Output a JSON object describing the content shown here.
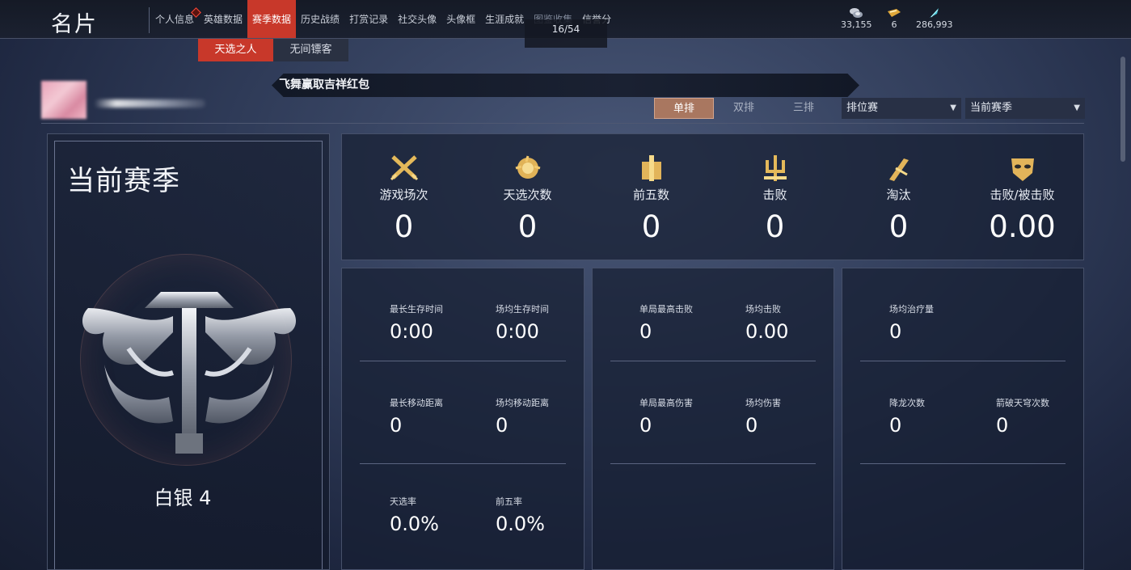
{
  "header": {
    "title": "名片",
    "nav": [
      "个人信息",
      "英雄数据",
      "赛季数据",
      "历史战绩",
      "打赏记录",
      "社交头像",
      "头像框",
      "生涯成就",
      "图鉴收集",
      "信誉分"
    ],
    "nav_active": "赛季数据",
    "progress": "16/54",
    "currencies": [
      {
        "icon": "coin-stack-icon",
        "value": "33,155"
      },
      {
        "icon": "ticket-icon",
        "value": "6"
      },
      {
        "icon": "feather-gem-icon",
        "value": "286,993"
      }
    ]
  },
  "subtabs": [
    "天选之人",
    "无间镖客"
  ],
  "subtab_active": "天选之人",
  "marquee_text": "飞舞赢取吉祥红包",
  "mode_tabs": [
    "单排",
    "双排",
    "三排"
  ],
  "mode_active": "单排",
  "filters": {
    "match_type": "排位赛",
    "season": "当前赛季"
  },
  "season_panel": {
    "title": "当前赛季",
    "rank": "白银 4"
  },
  "stats": [
    {
      "icon": "crossed-swords-icon",
      "label": "游戏场次",
      "value": "0"
    },
    {
      "icon": "lotus-emblem-icon",
      "label": "天选次数",
      "value": "0"
    },
    {
      "icon": "podium-icon",
      "label": "前五数",
      "value": "0"
    },
    {
      "icon": "trident-icon",
      "label": "击败",
      "value": "0"
    },
    {
      "icon": "broken-blade-icon",
      "label": "淘汰",
      "value": "0"
    },
    {
      "icon": "mask-icon",
      "label": "击败/被击败",
      "value": "0.00"
    }
  ],
  "details": {
    "survival": [
      {
        "label": "最长生存时间",
        "value": "0:00"
      },
      {
        "label": "场均生存时间",
        "value": "0:00"
      },
      {
        "label": "最长移动距离",
        "value": "0"
      },
      {
        "label": "场均移动距离",
        "value": "0"
      },
      {
        "label": "天选率",
        "value": "0.0%"
      },
      {
        "label": "前五率",
        "value": "0.0%"
      }
    ],
    "combat": [
      {
        "label": "单局最高击败",
        "value": "0"
      },
      {
        "label": "场均击败",
        "value": "0.00"
      },
      {
        "label": "单局最高伤害",
        "value": "0"
      },
      {
        "label": "场均伤害",
        "value": "0"
      }
    ],
    "misc": [
      {
        "label": "场均治疗量",
        "value": "0"
      },
      {
        "label": "降龙次数",
        "value": "0"
      },
      {
        "label": "箭破天穹次数",
        "value": "0"
      }
    ]
  }
}
